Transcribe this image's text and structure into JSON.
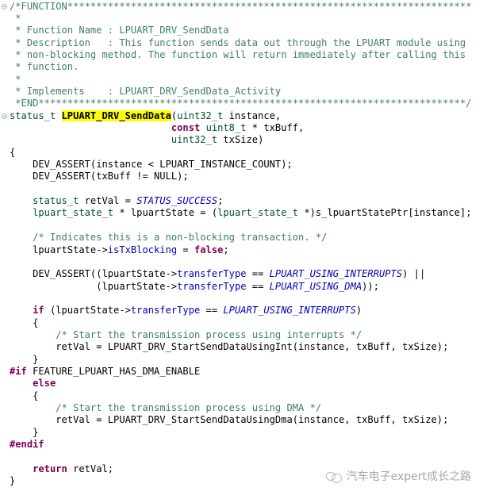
{
  "editor": {
    "lines": [
      [
        {
          "t": "/*FUNCTION**********************************************************************",
          "c": "c"
        }
      ],
      [
        {
          "t": " *",
          "c": "c"
        }
      ],
      [
        {
          "t": " * Function Name : LPUART_DRV_SendData",
          "c": "c"
        }
      ],
      [
        {
          "t": " * Description   : This function sends data out through the LPUART module using",
          "c": "c"
        }
      ],
      [
        {
          "t": " * non-blocking method. The function will return immediately after calling this",
          "c": "c"
        }
      ],
      [
        {
          "t": " * function.",
          "c": "c"
        }
      ],
      [
        {
          "t": " *",
          "c": "c"
        }
      ],
      [
        {
          "t": " * Implements    : LPUART_DRV_SendData_Activity",
          "c": "c"
        }
      ],
      [
        {
          "t": " *END**************************************************************************/",
          "c": "c"
        }
      ],
      [
        {
          "t": "status_t ",
          "c": "t"
        },
        {
          "t": "LPUART_DRV_SendData",
          "c": "f"
        },
        {
          "t": "(",
          "c": ""
        },
        {
          "t": "uint32_t",
          "c": "t"
        },
        {
          "t": " instance,",
          "c": ""
        }
      ],
      [
        {
          "t": "                            ",
          "c": ""
        },
        {
          "t": "const",
          "c": "k"
        },
        {
          "t": " ",
          "c": ""
        },
        {
          "t": "uint8_t",
          "c": "t"
        },
        {
          "t": " * txBuff,",
          "c": ""
        }
      ],
      [
        {
          "t": "                            ",
          "c": ""
        },
        {
          "t": "uint32_t",
          "c": "t"
        },
        {
          "t": " txSize)",
          "c": ""
        }
      ],
      [
        {
          "t": "{",
          "c": ""
        }
      ],
      [
        {
          "t": "    DEV_ASSERT(instance < LPUART_INSTANCE_COUNT);",
          "c": ""
        }
      ],
      [
        {
          "t": "    DEV_ASSERT(txBuff != NULL);",
          "c": ""
        }
      ],
      [],
      [
        {
          "t": "    ",
          "c": ""
        },
        {
          "t": "status_t",
          "c": "t"
        },
        {
          "t": " retVal = ",
          "c": ""
        },
        {
          "t": "STATUS_SUCCESS",
          "c": "e"
        },
        {
          "t": ";",
          "c": ""
        }
      ],
      [
        {
          "t": "    ",
          "c": ""
        },
        {
          "t": "lpuart_state_t",
          "c": "t"
        },
        {
          "t": " * lpuartState = (",
          "c": ""
        },
        {
          "t": "lpuart_state_t",
          "c": "t"
        },
        {
          "t": " *)s_lpuartStatePtr[instance];",
          "c": ""
        }
      ],
      [],
      [
        {
          "t": "    /* Indicates this is a non-blocking transaction. */",
          "c": "c"
        }
      ],
      [
        {
          "t": "    lpuartState->",
          "c": ""
        },
        {
          "t": "isTxBlocking",
          "c": "m"
        },
        {
          "t": " = ",
          "c": ""
        },
        {
          "t": "false",
          "c": "k"
        },
        {
          "t": ";",
          "c": ""
        }
      ],
      [],
      [
        {
          "t": "    DEV_ASSERT((lpuartState->",
          "c": ""
        },
        {
          "t": "transferType",
          "c": "m"
        },
        {
          "t": " == ",
          "c": ""
        },
        {
          "t": "LPUART_USING_INTERRUPTS",
          "c": "e"
        },
        {
          "t": ") ||",
          "c": ""
        }
      ],
      [
        {
          "t": "               (lpuartState->",
          "c": ""
        },
        {
          "t": "transferType",
          "c": "m"
        },
        {
          "t": " == ",
          "c": ""
        },
        {
          "t": "LPUART_USING_DMA",
          "c": "e"
        },
        {
          "t": "));",
          "c": ""
        }
      ],
      [],
      [
        {
          "t": "    ",
          "c": ""
        },
        {
          "t": "if",
          "c": "k"
        },
        {
          "t": " (lpuartState->",
          "c": ""
        },
        {
          "t": "transferType",
          "c": "m"
        },
        {
          "t": " == ",
          "c": ""
        },
        {
          "t": "LPUART_USING_INTERRUPTS",
          "c": "e"
        },
        {
          "t": ")",
          "c": ""
        }
      ],
      [
        {
          "t": "    {",
          "c": ""
        }
      ],
      [
        {
          "t": "        /* Start the transmission process using interrupts */",
          "c": "c"
        }
      ],
      [
        {
          "t": "        retVal = LPUART_DRV_StartSendDataUsingInt(instance, txBuff, txSize);",
          "c": ""
        }
      ],
      [
        {
          "t": "    }",
          "c": ""
        }
      ],
      [
        {
          "t": "#if",
          "c": "pp"
        },
        {
          "t": " FEATURE_LPUART_HAS_DMA_ENABLE",
          "c": ""
        }
      ],
      [
        {
          "t": "    ",
          "c": ""
        },
        {
          "t": "else",
          "c": "k"
        }
      ],
      [
        {
          "t": "    {",
          "c": ""
        }
      ],
      [
        {
          "t": "        /* Start the transmission process using DMA */",
          "c": "c"
        }
      ],
      [
        {
          "t": "        retVal = LPUART_DRV_StartSendDataUsingDma(instance, txBuff, txSize);",
          "c": ""
        }
      ],
      [
        {
          "t": "    }",
          "c": ""
        }
      ],
      [
        {
          "t": "#endif",
          "c": "pp"
        }
      ],
      [],
      [
        {
          "t": "    ",
          "c": ""
        },
        {
          "t": "return",
          "c": "k"
        },
        {
          "t": " retVal;",
          "c": ""
        }
      ],
      [
        {
          "t": "}",
          "c": ""
        }
      ]
    ],
    "fold_markers_on_lines": [
      0,
      9
    ]
  },
  "watermark": {
    "icon": "wechat-icon",
    "text": "汽车电子expert成长之路"
  },
  "colors": {
    "comment": "#3f7f5f",
    "keyword": "#7f0055",
    "type": "#005032",
    "field": "#0000c0",
    "highlight": "#ffff00"
  }
}
